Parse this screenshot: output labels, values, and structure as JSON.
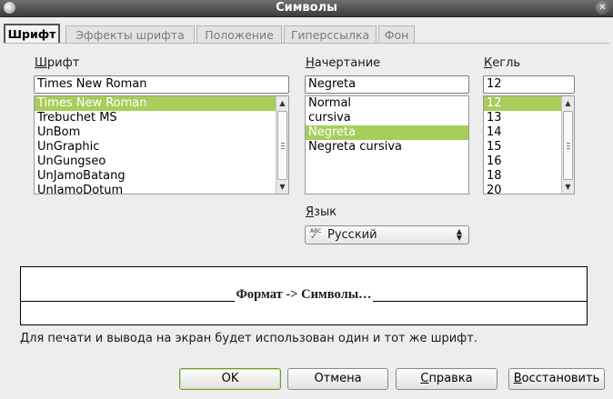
{
  "window": {
    "title": "Символы"
  },
  "tabs": [
    {
      "label": "Шрифт",
      "active": true
    },
    {
      "label": "Эффекты шрифта",
      "active": false
    },
    {
      "label": "Положение",
      "active": false
    },
    {
      "label": "Гиперссылка",
      "active": false
    },
    {
      "label": "Фон",
      "active": false
    }
  ],
  "font": {
    "label_mnemonic": "Ш",
    "label_rest": "рифт",
    "value": "Times New Roman",
    "items": [
      "Times New Roman",
      "Trebuchet MS",
      "UnBom",
      "UnGraphic",
      "UnGungseo",
      "UnJamoBatang",
      "UnJamoDotum"
    ],
    "selected_index": 0
  },
  "style": {
    "label_mnemonic": "Н",
    "label_rest": "ачертание",
    "value": "Negreta",
    "items": [
      "Normal",
      "cursiva",
      "Negreta",
      "Negreta cursiva"
    ],
    "selected_index": 2
  },
  "size": {
    "label_mnemonic": "К",
    "label_rest": "егль",
    "value": "12",
    "items": [
      "12",
      "13",
      "14",
      "15",
      "16",
      "18",
      "20"
    ],
    "selected_index": 0
  },
  "language": {
    "label_mnemonic": "Я",
    "label_rest": "зык",
    "value": "Русский"
  },
  "preview": {
    "sample": "Формат -> Символы…"
  },
  "note": "Для печати и вывода на экран будет использован один и тот же шрифт.",
  "buttons": {
    "ok": "OK",
    "cancel": "Отмена",
    "help_mnemonic": "С",
    "help_rest": "правка",
    "reset_mnemonic": "В",
    "reset_rest": "осстановить"
  },
  "colors": {
    "selection": "#a7cd5b",
    "accent_border": "#6f9a3a"
  }
}
